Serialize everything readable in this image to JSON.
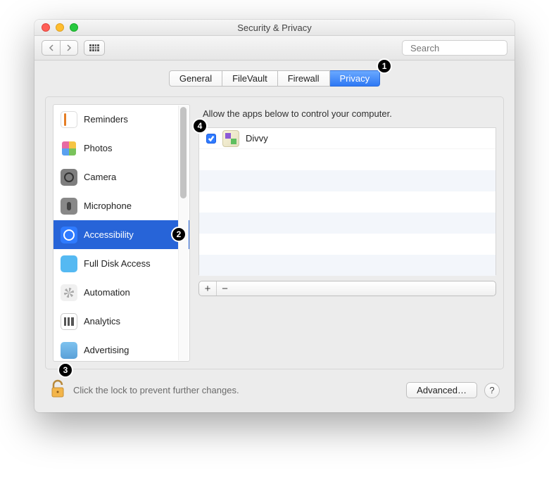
{
  "window": {
    "title": "Security & Privacy"
  },
  "toolbar": {
    "search_placeholder": "Search"
  },
  "tabs": [
    {
      "label": "General",
      "selected": false
    },
    {
      "label": "FileVault",
      "selected": false
    },
    {
      "label": "Firewall",
      "selected": false
    },
    {
      "label": "Privacy",
      "selected": true
    }
  ],
  "sidebar": {
    "items": [
      {
        "label": "Reminders",
        "icon": "reminders-icon",
        "selected": false
      },
      {
        "label": "Photos",
        "icon": "photos-icon",
        "selected": false
      },
      {
        "label": "Camera",
        "icon": "camera-icon",
        "selected": false
      },
      {
        "label": "Microphone",
        "icon": "microphone-icon",
        "selected": false
      },
      {
        "label": "Accessibility",
        "icon": "accessibility-icon",
        "selected": true
      },
      {
        "label": "Full Disk Access",
        "icon": "folder-icon",
        "selected": false
      },
      {
        "label": "Automation",
        "icon": "gear-icon",
        "selected": false
      },
      {
        "label": "Analytics",
        "icon": "chart-icon",
        "selected": false
      },
      {
        "label": "Advertising",
        "icon": "megaphone-icon",
        "selected": false
      }
    ]
  },
  "main": {
    "hint": "Allow the apps below to control your computer.",
    "apps": [
      {
        "name": "Divvy",
        "checked": true
      }
    ]
  },
  "footer": {
    "lock_text": "Click the lock to prevent further changes.",
    "advanced_label": "Advanced…",
    "help_label": "?"
  },
  "annotations": [
    {
      "n": "1",
      "desc": "Privacy tab"
    },
    {
      "n": "2",
      "desc": "Accessibility sidebar item"
    },
    {
      "n": "3",
      "desc": "Lock icon"
    },
    {
      "n": "4",
      "desc": "App checkbox"
    }
  ]
}
